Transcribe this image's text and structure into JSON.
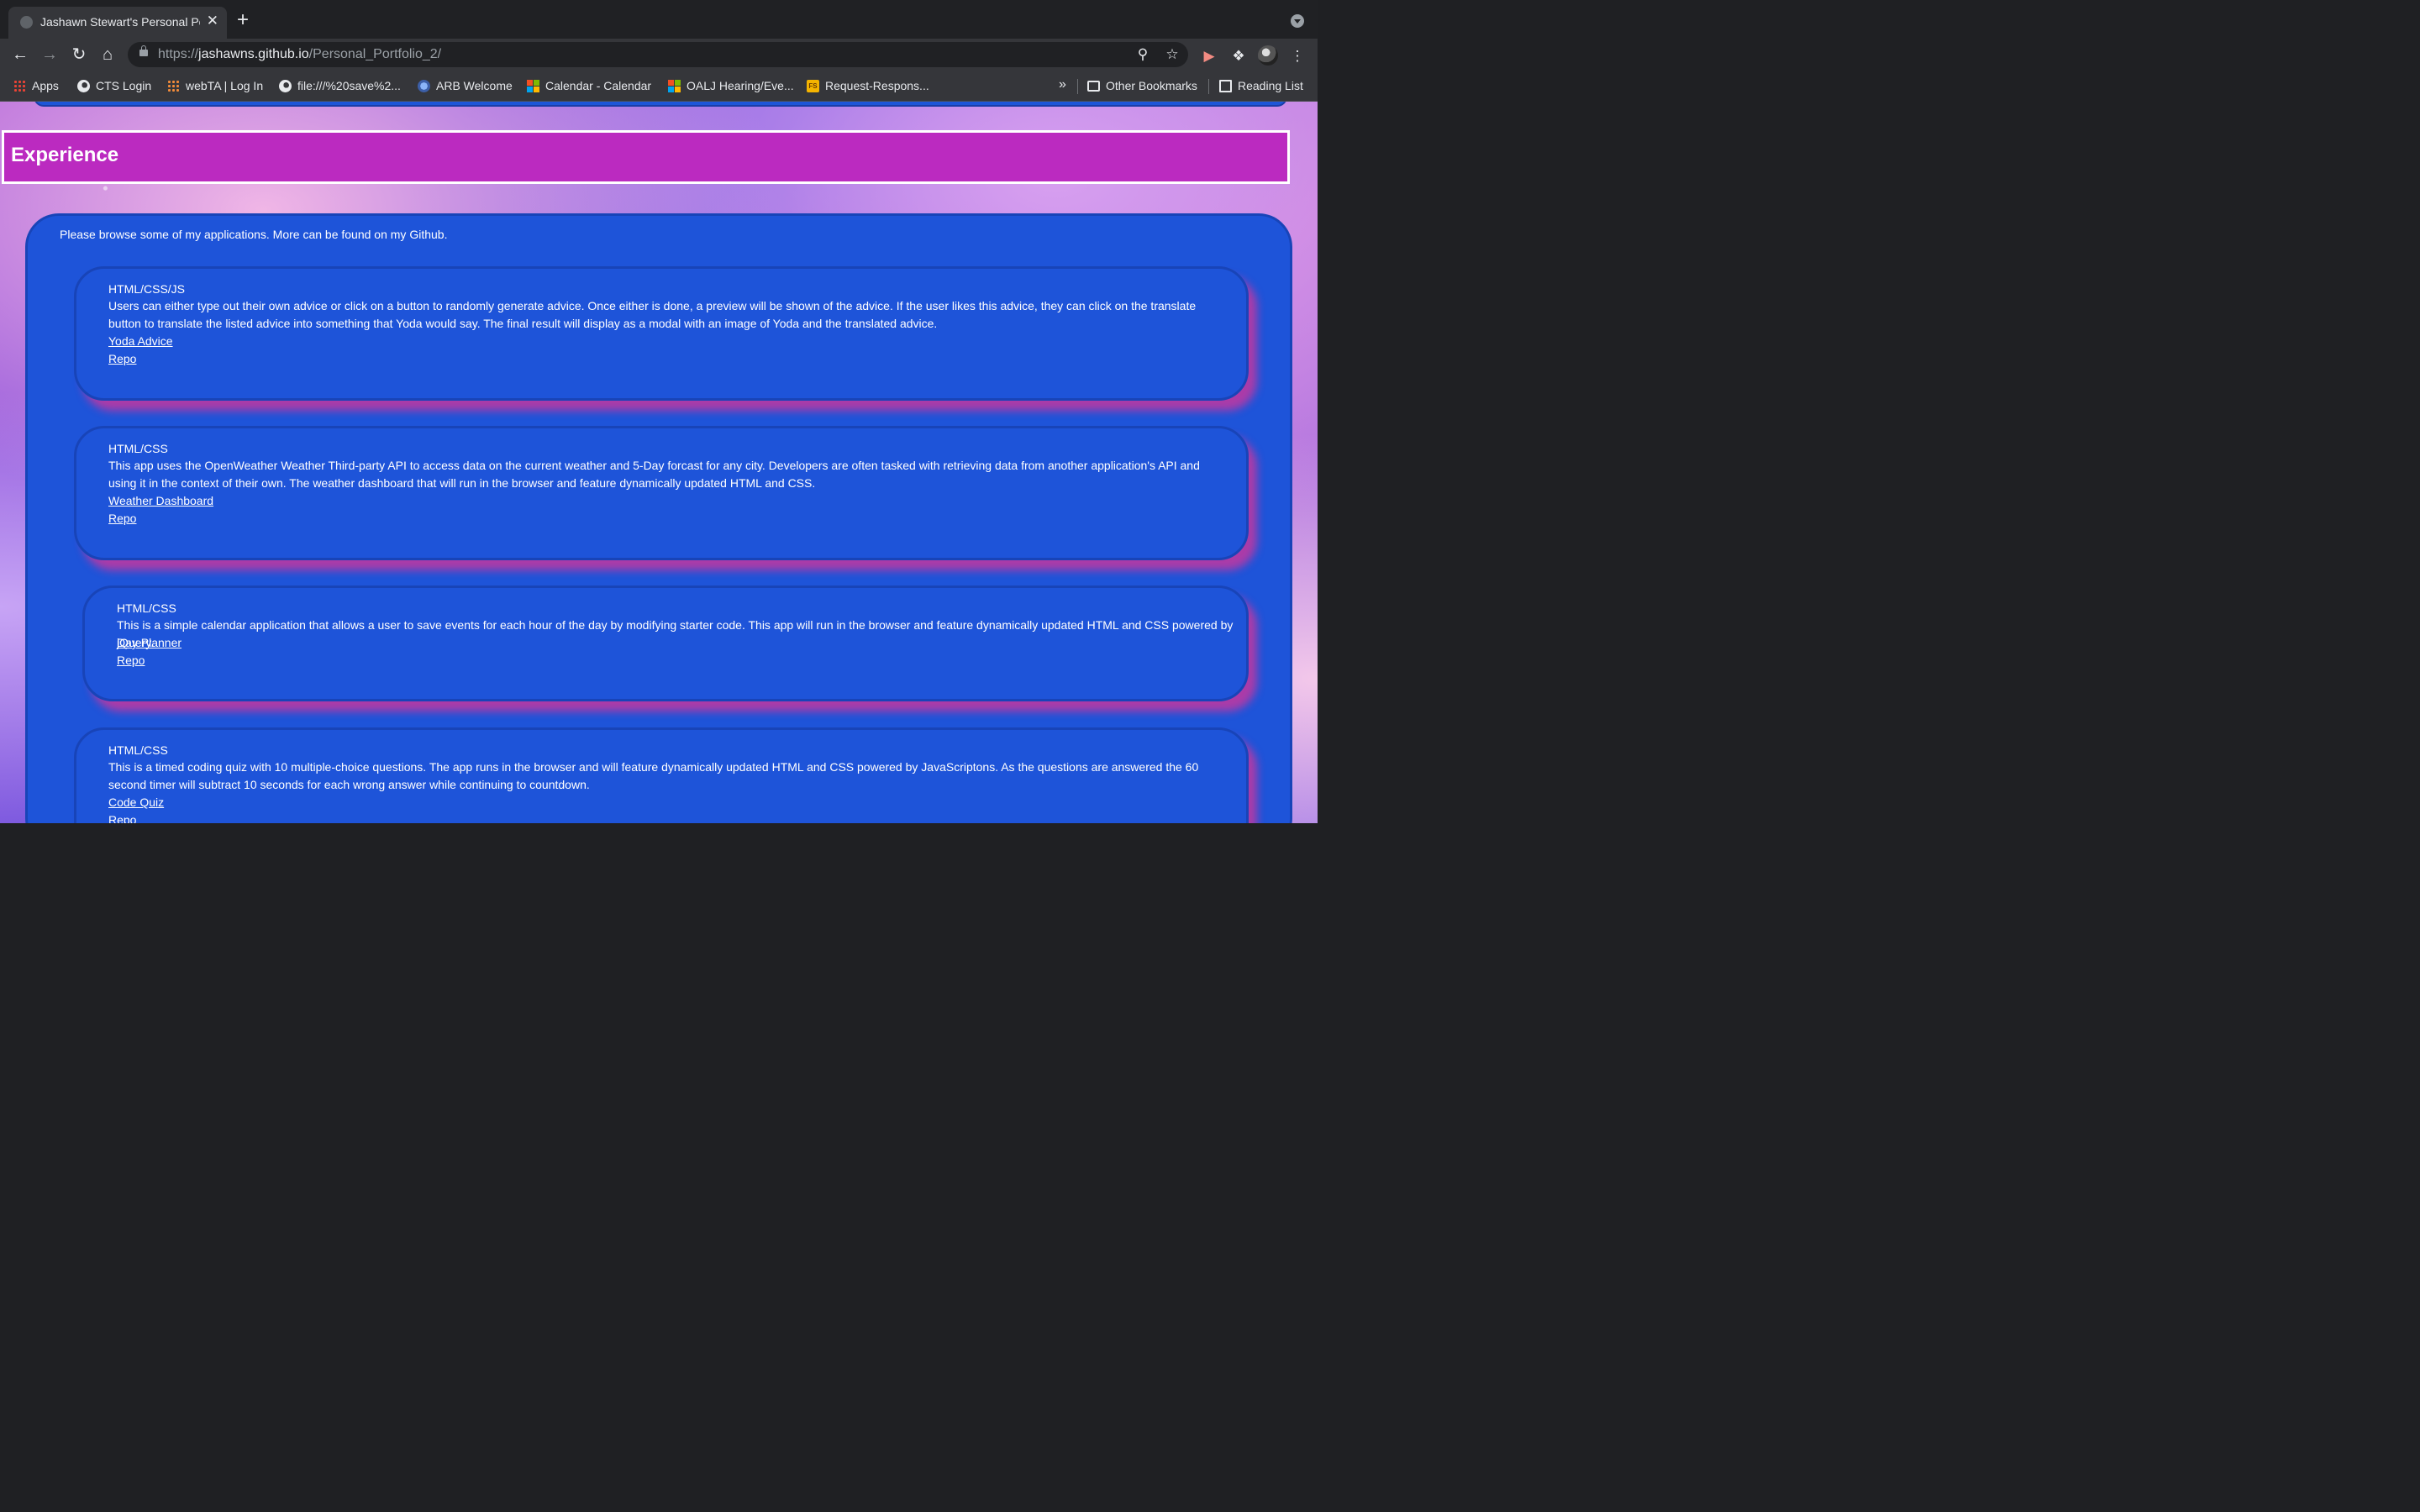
{
  "browser": {
    "tab_title": "Jashawn Stewart's Personal Po",
    "tab_close": "✕",
    "new_tab": "+",
    "url_scheme": "https://",
    "url_host": "jashawns.github.io",
    "url_path": "/Personal_Portfolio_2/",
    "bookmarks": [
      {
        "label": "Apps",
        "icon": "apps-grid-icon"
      },
      {
        "label": "CTS Login",
        "icon": "globe-icon"
      },
      {
        "label": "webTA | Log In",
        "icon": "webta-icon"
      },
      {
        "label": "file:///%20save%2...",
        "icon": "globe-icon"
      },
      {
        "label": "ARB Welcome",
        "icon": "arb-seal-icon"
      },
      {
        "label": "Calendar - Calendar",
        "icon": "microsoft-icon"
      },
      {
        "label": "OALJ Hearing/Eve...",
        "icon": "microsoft-icon"
      },
      {
        "label": "Request-Respons...",
        "icon": "fs-icon"
      }
    ],
    "bookmarks_more": "»",
    "other_bookmarks": "Other Bookmarks",
    "reading_list": "Reading List"
  },
  "page": {
    "section_title": "Experience",
    "intro": "Please browse some of my applications. More can be found on my Github.",
    "projects": [
      {
        "tag": "HTML/CSS/JS",
        "description": "Users can either type out their own advice or click on a button to randomly generate advice. Once either is done, a preview will be shown of the advice. If the user likes this advice, they can click on the translate button to translate the listed advice into something that Yoda would say. The final result will display as a modal with an image of Yoda and the translated advice.",
        "app_link": "Yoda Advice",
        "repo_link": "Repo"
      },
      {
        "tag": "HTML/CSS",
        "description": "This app uses the OpenWeather Weather Third-party API to access data on the current weather and 5-Day forcast for any city. Developers are often tasked with retrieving data from another application's API and using it in the context of their own. The weather dashboard that will run in the browser and feature dynamically updated HTML and CSS.",
        "app_link": "Weather Dashboard",
        "repo_link": "Repo"
      },
      {
        "tag": "HTML/CSS",
        "description": "This is a simple calendar application that allows a user to save events for each hour of the day by modifying starter code. This app will run in the browser and feature dynamically updated HTML and CSS powered by jQuery.",
        "app_link": "Day Planner",
        "repo_link": "Repo"
      },
      {
        "tag": "HTML/CSS",
        "description": "This is a timed coding quiz with 10 multiple-choice questions. The app runs in the browser and will feature dynamically updated HTML and CSS powered by JavaScriptons. As the questions are answered the 60 second timer will subtract 10 seconds for each wrong answer while continuing to countdown.",
        "app_link": "Code Quiz",
        "repo_link": "Repo"
      }
    ]
  },
  "colors": {
    "header_magenta": "#bb2ac0",
    "panel_blue": "#1e54d9",
    "card_shadow": "#c437a0"
  }
}
